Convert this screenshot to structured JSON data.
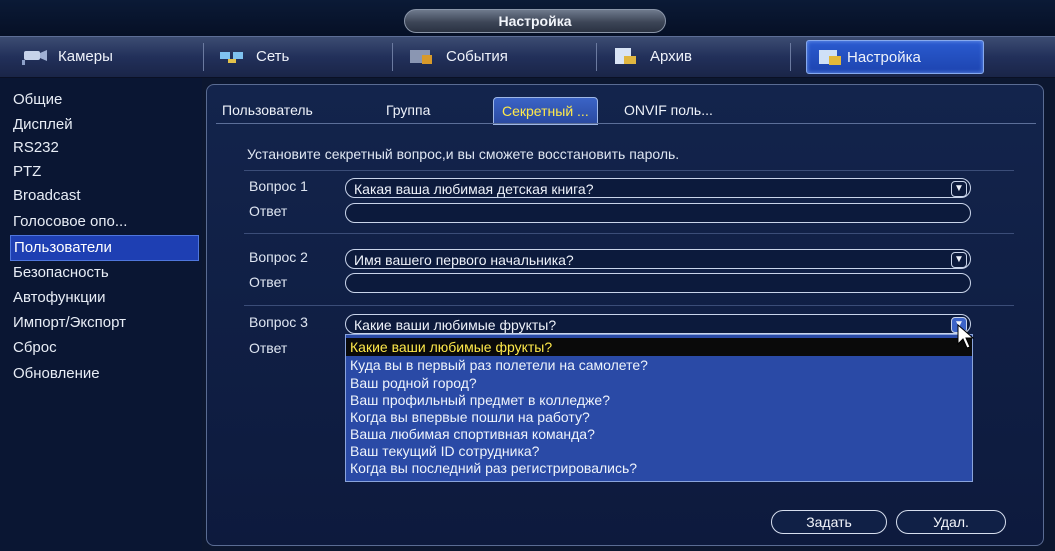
{
  "window": {
    "title": "Настройка"
  },
  "nav": {
    "tabs": [
      {
        "label": "Камеры",
        "icon": "camera-icon"
      },
      {
        "label": "Сеть",
        "icon": "network-icon"
      },
      {
        "label": "События",
        "icon": "events-icon"
      },
      {
        "label": "Архив",
        "icon": "archive-icon"
      },
      {
        "label": "Настройка",
        "icon": "settings-icon",
        "active": true
      }
    ]
  },
  "sidebar": {
    "items": [
      {
        "label": "Общие"
      },
      {
        "label": "Дисплей"
      },
      {
        "label": "RS232"
      },
      {
        "label": "PTZ"
      },
      {
        "label": "Broadcast"
      },
      {
        "label": "Голосовое опо..."
      },
      {
        "label": "Пользователи",
        "active": true
      },
      {
        "label": "Безопасность"
      },
      {
        "label": "Автофункции"
      },
      {
        "label": "Импорт/Экспорт"
      },
      {
        "label": "Сброс"
      },
      {
        "label": "Обновление"
      }
    ]
  },
  "subtabs": [
    {
      "label": "Пользователь"
    },
    {
      "label": "Группа"
    },
    {
      "label": "Секретный ...",
      "active": true
    },
    {
      "label": "ONVIF поль..."
    }
  ],
  "info_text": "Установите секретный вопрос,и вы сможете восстановить пароль.",
  "questions": [
    {
      "label": "Вопрос 1",
      "value": "Какая ваша любимая детская книга?",
      "answer_label": "Ответ",
      "answer": ""
    },
    {
      "label": "Вопрос 2",
      "value": "Имя вашего первого начальника?",
      "answer_label": "Ответ",
      "answer": ""
    },
    {
      "label": "Вопрос 3",
      "value": "Какие ваши любимые фрукты?",
      "answer_label": "Ответ",
      "answer": ""
    }
  ],
  "dropdown": {
    "selected_index": 0,
    "options": [
      "Какие ваши любимые фрукты?",
      "Куда вы в первый раз полетели на самолете?",
      "Ваш родной город?",
      "Ваш профильный предмет в колледже?",
      "Когда вы впервые пошли на работу?",
      "Ваша любимая спортивная команда?",
      "Ваш текущий ID сотрудника?",
      "Когда вы последний раз регистрировались?"
    ]
  },
  "buttons": {
    "set": "Задать",
    "delete": "Удал."
  },
  "colors": {
    "accent": "#1e3fb3",
    "highlight_text": "#ffe94a",
    "background": "#0c1730"
  }
}
